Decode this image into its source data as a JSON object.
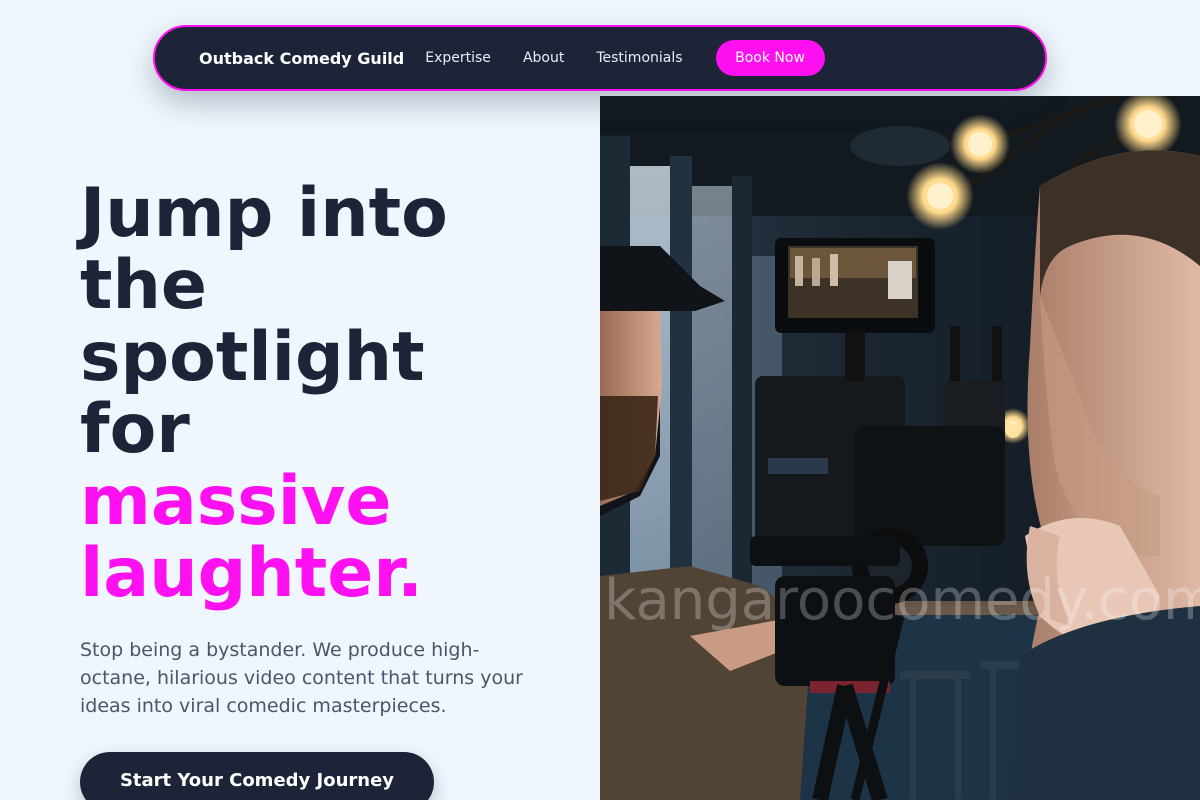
{
  "nav": {
    "brand": "Outback Comedy Guild",
    "links": [
      "Expertise",
      "About",
      "Testimonials"
    ],
    "cta_label": "Book Now"
  },
  "hero": {
    "headline_lines": [
      "Jump into",
      "the",
      "spotlight",
      "for"
    ],
    "headline_accent_lines": [
      "massive",
      "laughter."
    ],
    "subtitle": "Stop being a bystander. We produce high-octane, hilarious video content that turns your ideas into viral comedic masterpieces.",
    "cta_label": "Start Your Comedy Journey",
    "image": {
      "description_icon": "camera-crew-photo",
      "watermark": "kangaroocomedy.com"
    }
  },
  "colors": {
    "accent": "#ff10f0",
    "dark": "#1e2438",
    "background": "#eff6fd"
  }
}
